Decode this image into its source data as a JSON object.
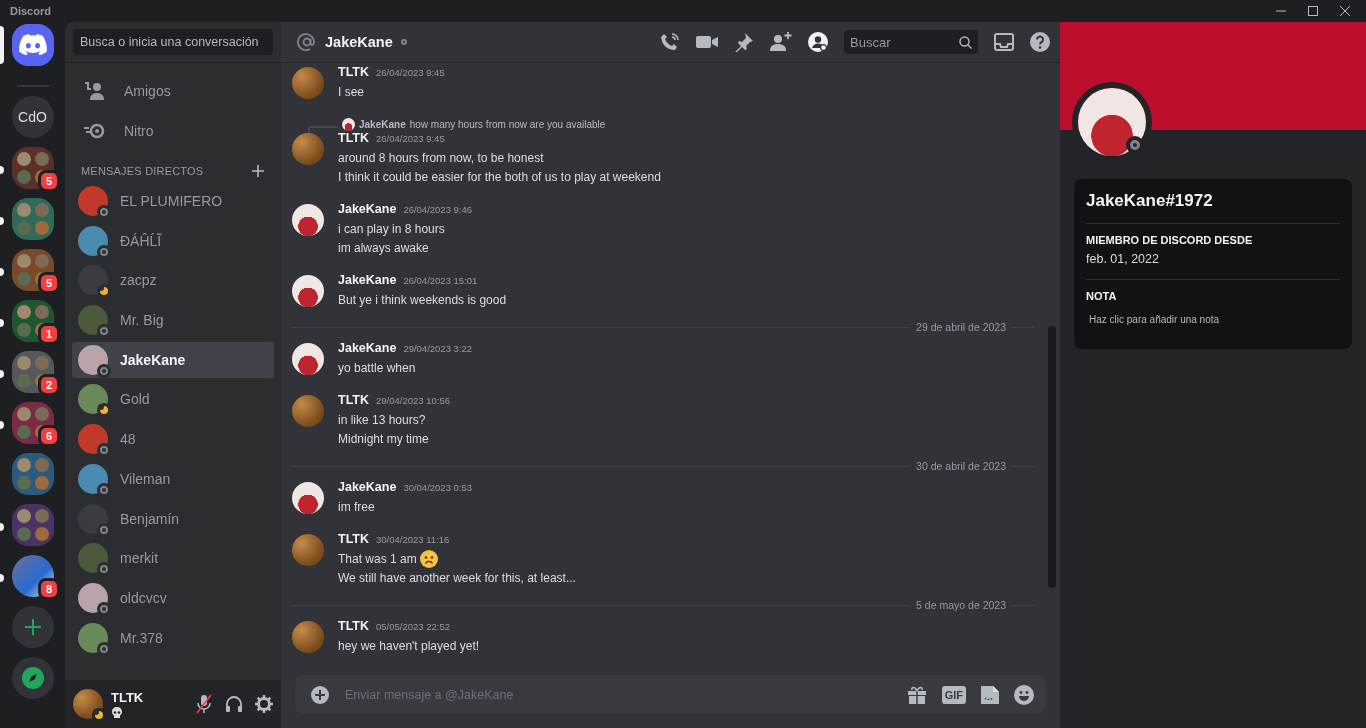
{
  "window": {
    "title": "Discord"
  },
  "servers": [
    {
      "kind": "home",
      "selected": true
    },
    {
      "kind": "text",
      "label": "CdO",
      "selected": false,
      "unread": false
    },
    {
      "kind": "folder",
      "color": "#5c2f2a",
      "badge": "5",
      "selected": false,
      "unread": true
    },
    {
      "kind": "folder",
      "color": "#2f6b5b",
      "selected": false,
      "unread": true
    },
    {
      "kind": "folder",
      "color": "#7a4a28",
      "badge": "5",
      "selected": false,
      "unread": true
    },
    {
      "kind": "folder",
      "color": "#1f5533",
      "badge": "1",
      "selected": false,
      "unread": true
    },
    {
      "kind": "folder",
      "color": "#55595e",
      "badge": "2",
      "selected": false,
      "unread": true
    },
    {
      "kind": "folder",
      "color": "#7a2b45",
      "badge": "6",
      "selected": false,
      "unread": true
    },
    {
      "kind": "folder",
      "color": "#2c5a7c",
      "selected": false,
      "unread": false
    },
    {
      "kind": "folder",
      "color": "#4a3266",
      "selected": false,
      "unread": true
    },
    {
      "kind": "picture",
      "badge": "8",
      "selected": false,
      "unread": true
    },
    {
      "kind": "add",
      "selected": false,
      "unread": false
    },
    {
      "kind": "explore",
      "selected": false,
      "unread": false
    }
  ],
  "sidebar": {
    "search": {
      "placeholder": "Busca o inicia una conversación"
    },
    "nav": [
      {
        "kind": "friends",
        "label": "Amigos"
      },
      {
        "kind": "nitro",
        "label": "Nitro"
      }
    ],
    "dm_header": "MENSAJES DIRECTOS",
    "dms": [
      {
        "name": "EL PLUMIFERO",
        "idle": false,
        "selected": false
      },
      {
        "name": "ĐÁĤĹĨ",
        "idle": false,
        "selected": false
      },
      {
        "name": "zacpz",
        "idle": true,
        "selected": false
      },
      {
        "name": "Mr. Big",
        "idle": false,
        "selected": false
      },
      {
        "name": "JakeKane",
        "idle": false,
        "selected": true
      },
      {
        "name": "Gold",
        "idle": true,
        "selected": false
      },
      {
        "name": "48",
        "idle": false,
        "selected": false
      },
      {
        "name": "Vileman",
        "idle": false,
        "selected": false
      },
      {
        "name": "Benjamín",
        "idle": false,
        "selected": false
      },
      {
        "name": "merkit",
        "idle": false,
        "selected": false
      },
      {
        "name": "oldcvcv",
        "idle": false,
        "selected": false
      },
      {
        "name": "Mr.378",
        "idle": false,
        "selected": false
      }
    ]
  },
  "user_panel": {
    "name": "TLTK",
    "idle": true,
    "muted": true
  },
  "chat": {
    "recipient": "JakeKane",
    "idle": false,
    "profile_open": true,
    "search": {
      "placeholder": "Buscar"
    },
    "messages": [
      {
        "kind": "sent",
        "author": "TLTK",
        "time": "26/04/2023 9:45",
        "lines": [
          {
            "text": "I see",
            "emoji": false
          }
        ]
      },
      {
        "kind": "sent",
        "author": "TLTK",
        "time": "26/04/2023 9:45",
        "reply": {
          "author": "JakeKane",
          "text": "how many hours from now are you available"
        },
        "lines": [
          {
            "text": "around 8 hours from now, to be honest",
            "emoji": false
          },
          {
            "text": "I think it could be easier for the both of us to play at weekend",
            "emoji": false
          }
        ]
      },
      {
        "kind": "received",
        "author": "JakeKane",
        "time": "26/04/2023 9:46",
        "lines": [
          {
            "text": "i can play in 8 hours",
            "emoji": false
          },
          {
            "text": "im always awake",
            "emoji": false
          }
        ]
      },
      {
        "kind": "received",
        "author": "JakeKane",
        "time": "26/04/2023 15:01",
        "lines": [
          {
            "text": "But ye i think weekends is good",
            "emoji": false
          }
        ]
      },
      {
        "kind": "divider",
        "label": "29 de abril de 2023"
      },
      {
        "kind": "received",
        "author": "JakeKane",
        "time": "29/04/2023 3:22",
        "lines": [
          {
            "text": "yo battle when",
            "emoji": false
          }
        ]
      },
      {
        "kind": "sent",
        "author": "TLTK",
        "time": "29/04/2023 10:56",
        "lines": [
          {
            "text": "in like 13 hours?",
            "emoji": false
          },
          {
            "text": "Midnight my time",
            "emoji": false
          }
        ]
      },
      {
        "kind": "divider",
        "label": "30 de abril de 2023"
      },
      {
        "kind": "received",
        "author": "JakeKane",
        "time": "30/04/2023 0:53",
        "lines": [
          {
            "text": "im free",
            "emoji": false
          }
        ]
      },
      {
        "kind": "sent",
        "author": "TLTK",
        "time": "30/04/2023 11:16",
        "lines": [
          {
            "text": "That was 1 am",
            "emoji": true
          },
          {
            "text": "We still have another week for this, at least...",
            "emoji": false
          }
        ]
      },
      {
        "kind": "divider",
        "label": "5 de mayo de 2023"
      },
      {
        "kind": "sent",
        "author": "TLTK",
        "time": "05/05/2023 22:52",
        "lines": [
          {
            "text": "hey we haven't played yet!",
            "emoji": false
          }
        ]
      }
    ],
    "composer": {
      "placeholder": "Enviar mensaje a @JakeKane",
      "gif_label": "GIF"
    }
  },
  "profile": {
    "idle": false,
    "name": "JakeKane#1972",
    "sections": [
      {
        "heading": "MIEMBRO DE DISCORD DESDE",
        "value": "feb. 01, 2022",
        "kind": "text"
      },
      {
        "heading": "NOTA",
        "value": "Haz clic para añadir una nota",
        "kind": "note"
      }
    ]
  }
}
